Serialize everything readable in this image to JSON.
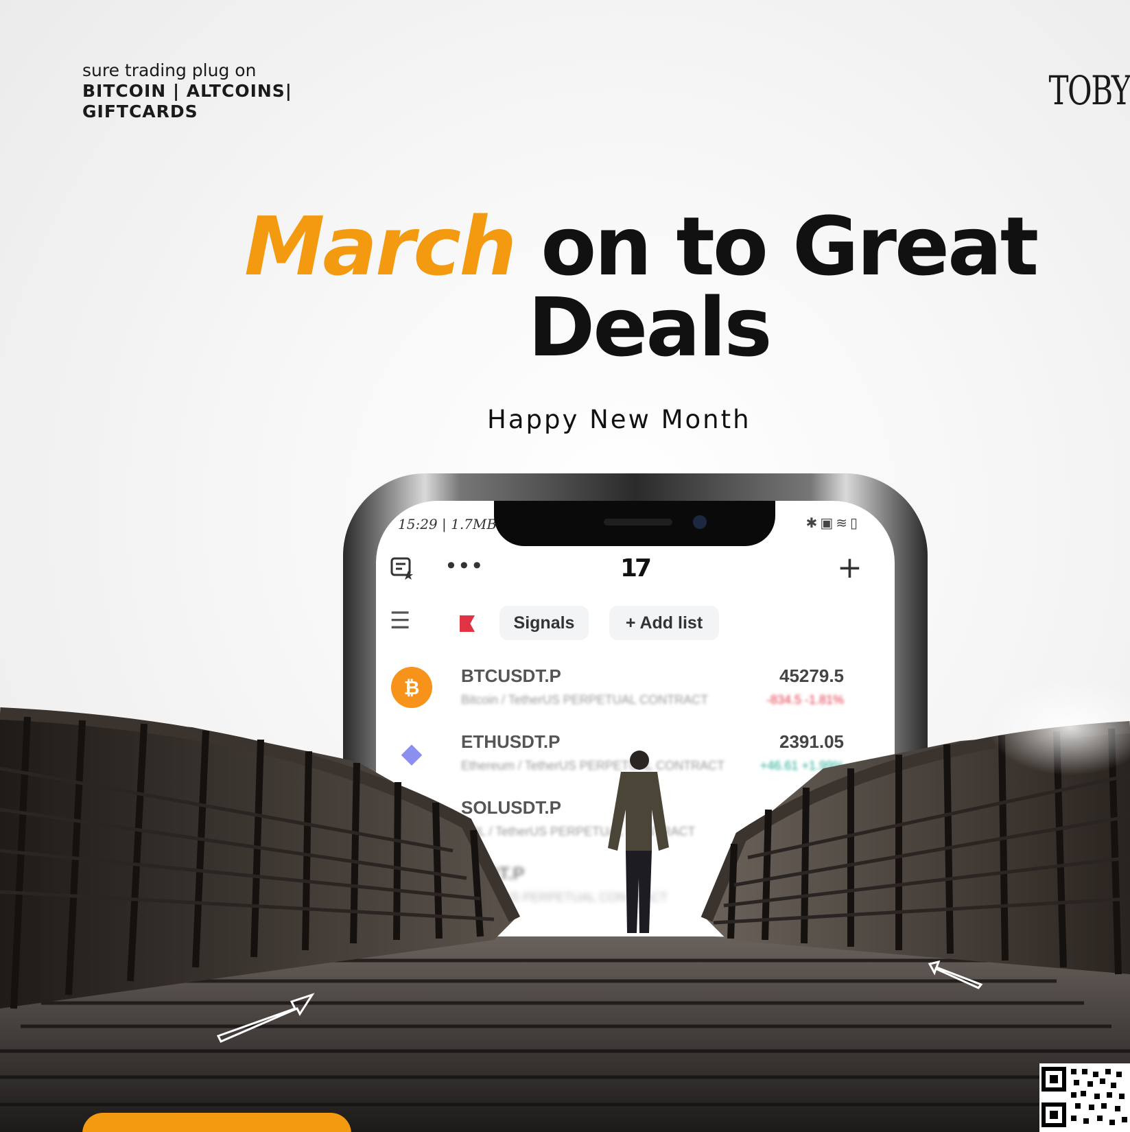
{
  "tagline": {
    "line1": "sure trading plug on",
    "line2": "BITCOIN | ALTCOINS|",
    "line3": "GIFTCARDS"
  },
  "brand": "TOBY",
  "headline": {
    "accent_word": "March",
    "rest_row1": "on to Great",
    "row2": "Deals",
    "accent_color": "#f39a10"
  },
  "subtitle": "Happy New Month",
  "phone": {
    "status_time": "15:29 | 1.7MB",
    "toolbar": {
      "left_icon": "watchlist-icon",
      "more_label": "•••",
      "logo": "17",
      "add_label": "+"
    },
    "tabs": {
      "menu_icon": "menu-icon",
      "flag_icon": "flag-icon",
      "signals": "Signals",
      "add_list": "+ Add list"
    },
    "rows": [
      {
        "symbol": "BTCUSDT.P",
        "description": "Bitcoin / TetherUS PERPETUAL CONTRACT",
        "price": "45279.5",
        "change": "-834.5  -1.81%",
        "change_color": "#e23344",
        "coin_color": "#f7931a",
        "coin_glyph": "₿"
      },
      {
        "symbol": "ETHUSDT.P",
        "description": "Ethereum / TetherUS PERPETUAL CONTRACT",
        "price": "2391.05",
        "change": "+46.61  +1.99%",
        "change_color": "#22ab94",
        "coin_color": "#c9c9f5",
        "coin_glyph": "◆"
      },
      {
        "symbol": "SOLUSDT.P",
        "description": "SOL / TetherUS PERPETUAL CONTRACT",
        "price": "",
        "change": "",
        "change_color": "#999999",
        "coin_color": "#dddddd",
        "coin_glyph": ""
      },
      {
        "symbol": "USDT.P",
        "description": "/ TetherUS PERPETUAL CONTRACT",
        "price": "",
        "change": "",
        "change_color": "#999999",
        "coin_color": "#dddddd",
        "coin_glyph": ""
      }
    ]
  }
}
